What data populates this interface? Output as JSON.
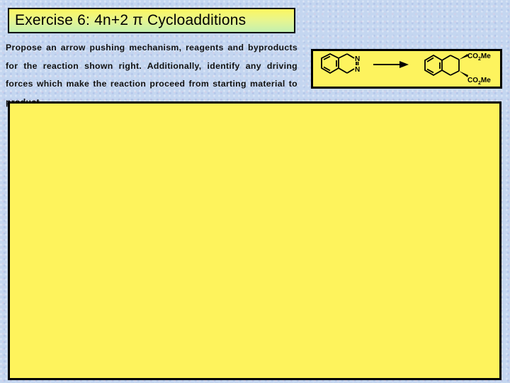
{
  "title": "Exercise 6: 4n+2 π Cycloadditions",
  "prompt": "Propose an arrow pushing mechanism, reagents and byproducts for the reaction shown right. Additionally, identify any driving forces which make the reaction proceed from starting material to product.",
  "scheme": {
    "reactant": {
      "name": "1,4-dihydrophthalazine (benzo-fused cyclic azo compound)",
      "atoms": [
        "N",
        "N"
      ]
    },
    "arrow": "reaction-arrow",
    "product": {
      "name": "dimethyl tetrahydronaphthalene-2,3-dicarboxylate",
      "substituent_top_main": "CO",
      "substituent_top_sub": "2",
      "substituent_top_tail": "Me",
      "substituent_bottom_main": "CO",
      "substituent_bottom_sub": "2",
      "substituent_bottom_tail": "Me"
    }
  },
  "answer_area": {
    "content": ""
  },
  "colors": {
    "background": "#c4d6f0",
    "box_fill": "#fef35c",
    "title_gradient_top": "#fdf760",
    "title_gradient_bottom": "#c3f0b0",
    "border": "#000000"
  }
}
